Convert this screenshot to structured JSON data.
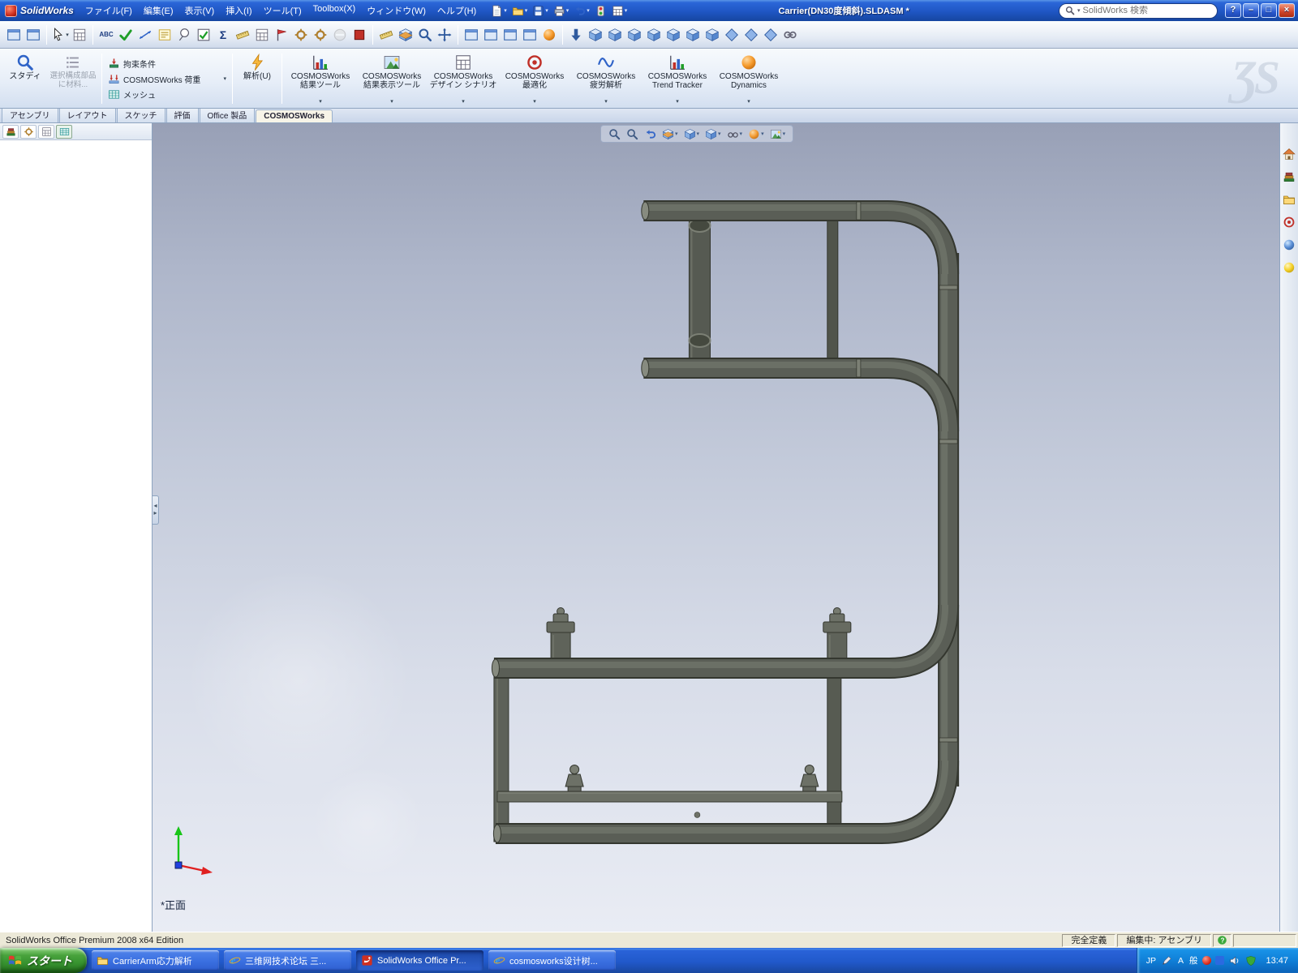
{
  "titlebar": {
    "app_name": "SolidWorks",
    "menus": [
      "ファイル(F)",
      "編集(E)",
      "表示(V)",
      "挿入(I)",
      "ツール(T)",
      "Toolbox(X)",
      "ウィンドウ(W)",
      "ヘルプ(H)"
    ],
    "doc_title": "Carrier(DN30度傾斜).SLDASM *",
    "search_placeholder": "SolidWorks 検索",
    "window_buttons": {
      "help": "?",
      "minimize": "–",
      "maximize": "□",
      "close": "×"
    }
  },
  "command_manager": {
    "study": "スタディ",
    "material": "選択構成部品に材料...",
    "stack": [
      "拘束条件",
      "COSMOSWorks 荷重",
      "メッシュ"
    ],
    "run": "解析(U)",
    "big_buttons": [
      "COSMOSWorks\n結果ツール",
      "COSMOSWorks\n結果表示ツール",
      "COSMOSWorks\nデザイン シナリオ",
      "COSMOSWorks\n最適化",
      "COSMOSWorks\n疲労解析",
      "COSMOSWorks\nTrend Tracker",
      "COSMOSWorks\nDynamics"
    ]
  },
  "tabs": {
    "items": [
      "アセンブリ",
      "レイアウト",
      "スケッチ",
      "評価",
      "Office 製品",
      "COSMOSWorks"
    ],
    "active": "COSMOSWorks"
  },
  "viewport": {
    "view_label": "*正面"
  },
  "statusbar": {
    "product": "SolidWorks Office Premium 2008 x64 Edition",
    "fully_defined": "完全定義",
    "editing": "編集中: アセンブリ"
  },
  "taskbar": {
    "start": "スタート",
    "tasks": [
      "CarrierArm応力解析",
      "三维网技术论坛 三...",
      "SolidWorks Office Pr...",
      "cosmosworks设计树..."
    ],
    "tray": {
      "ime_lang": "JP",
      "ime_mode": "A",
      "ime_conv": "般",
      "time": "13:47"
    }
  },
  "glyphs": {
    "caret": "▾",
    "abc": "ABC",
    "sigma": "Σ",
    "split_left": "◂",
    "split_right": "▸",
    "watermark": "ƷS"
  },
  "icons": {
    "titlebar_mini": [
      "new-document-icon",
      "open-icon",
      "save-icon",
      "print-icon",
      "undo-icon",
      "rebuild-icon",
      "options-icon"
    ],
    "heads_up": [
      "zoom-fit-icon",
      "zoom-area-icon",
      "previous-view-icon",
      "section-view-icon",
      "view-orientation-icon",
      "display-style-icon",
      "hide-show-items-icon",
      "edit-appearance-icon",
      "apply-scene-icon"
    ],
    "task_pane": [
      "solidworks-resources-icon",
      "design-library-icon",
      "file-explorer-icon",
      "view-palette-icon",
      "appearances-icon",
      "photoworks-icon"
    ],
    "panel_tabs": [
      "featuremanager-tab-icon",
      "propertymanager-tab-icon",
      "configurationmanager-tab-icon",
      "cosmosworks-tree-tab-icon"
    ]
  }
}
